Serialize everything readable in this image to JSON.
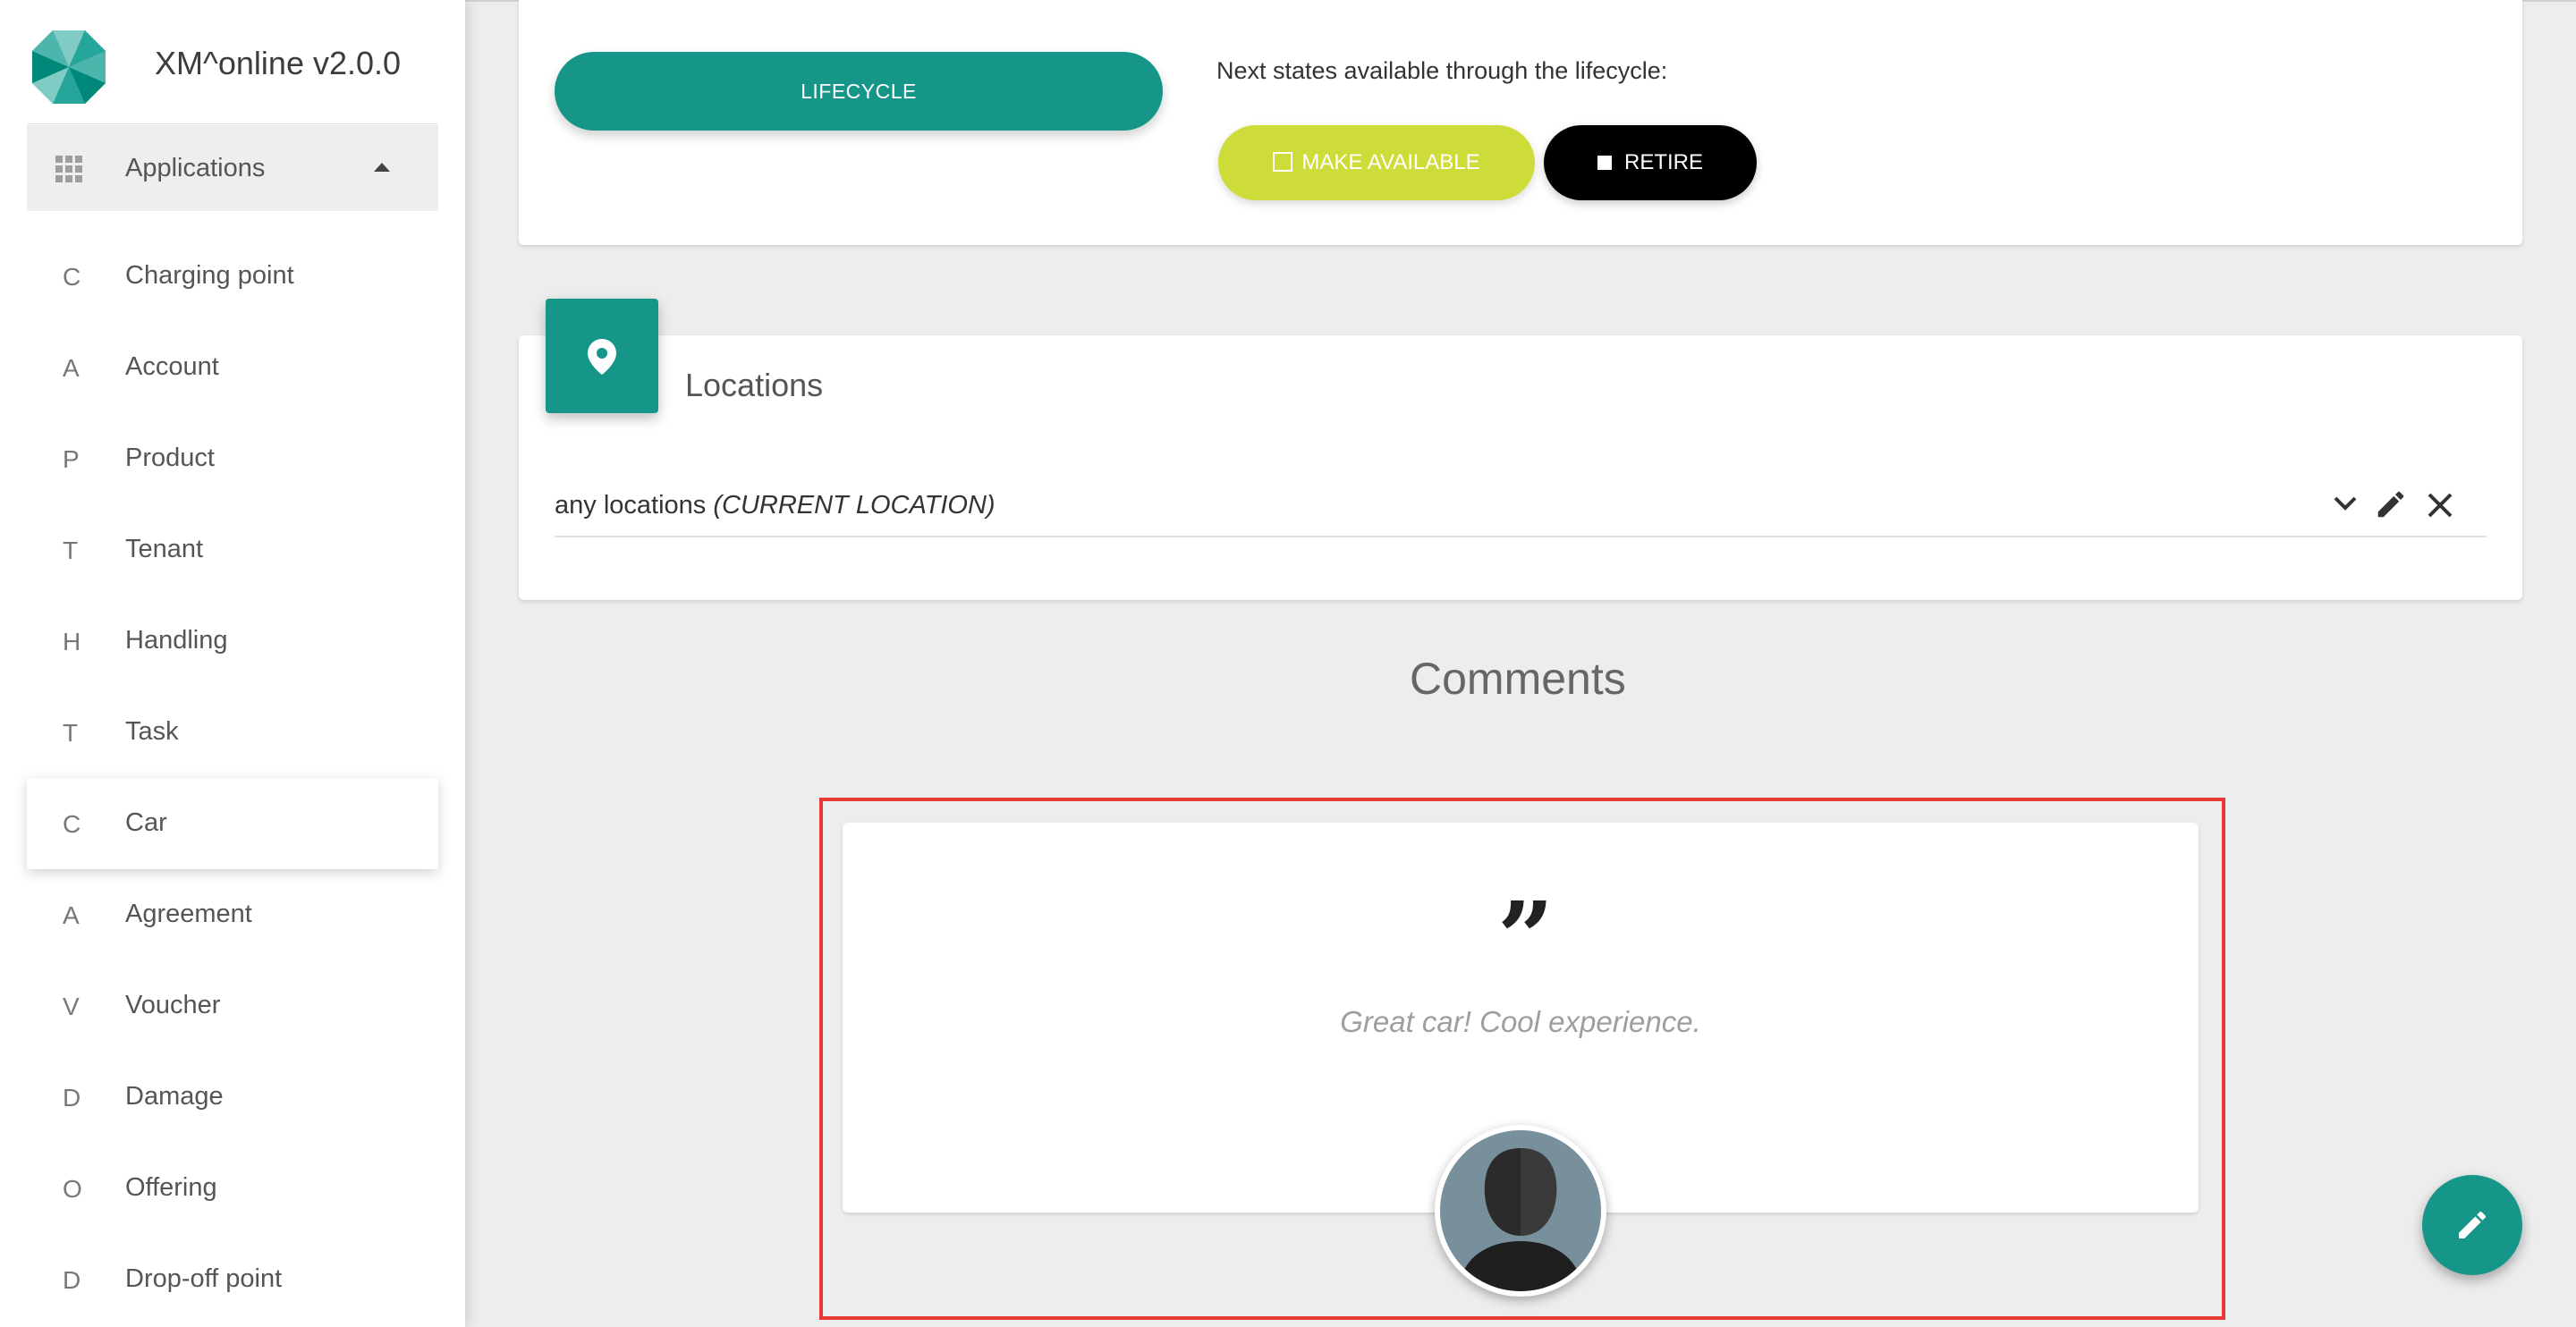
{
  "app": {
    "title": "XM^online v2.0.0",
    "accent_color": "#159688"
  },
  "sidebar": {
    "section_label": "Applications",
    "items": [
      {
        "letter": "C",
        "label": "Charging point"
      },
      {
        "letter": "A",
        "label": "Account"
      },
      {
        "letter": "P",
        "label": "Product"
      },
      {
        "letter": "T",
        "label": "Tenant"
      },
      {
        "letter": "H",
        "label": "Handling"
      },
      {
        "letter": "T",
        "label": "Task"
      },
      {
        "letter": "C",
        "label": "Car",
        "active": true
      },
      {
        "letter": "A",
        "label": "Agreement"
      },
      {
        "letter": "V",
        "label": "Voucher"
      },
      {
        "letter": "D",
        "label": "Damage"
      },
      {
        "letter": "O",
        "label": "Offering"
      },
      {
        "letter": "D",
        "label": "Drop-off point"
      }
    ]
  },
  "lifecycle": {
    "button_label": "LIFECYCLE",
    "next_states_label": "Next states available through the lifecycle:",
    "make_available_label": "MAKE AVAILABLE",
    "make_available_color": "#cddc39",
    "retire_label": "RETIRE",
    "retire_color": "#000000"
  },
  "locations": {
    "title": "Locations",
    "item_text": "any locations",
    "item_tag": "(CURRENT LOCATION)",
    "icons": [
      "location-pin-icon",
      "chevron-down-icon",
      "pencil-icon",
      "close-icon"
    ]
  },
  "comments": {
    "title": "Comments",
    "quote_glyph": "”",
    "text": "Great car! Cool experience.",
    "highlight_color": "#e53935"
  },
  "fab": {
    "icon": "pencil-icon"
  }
}
